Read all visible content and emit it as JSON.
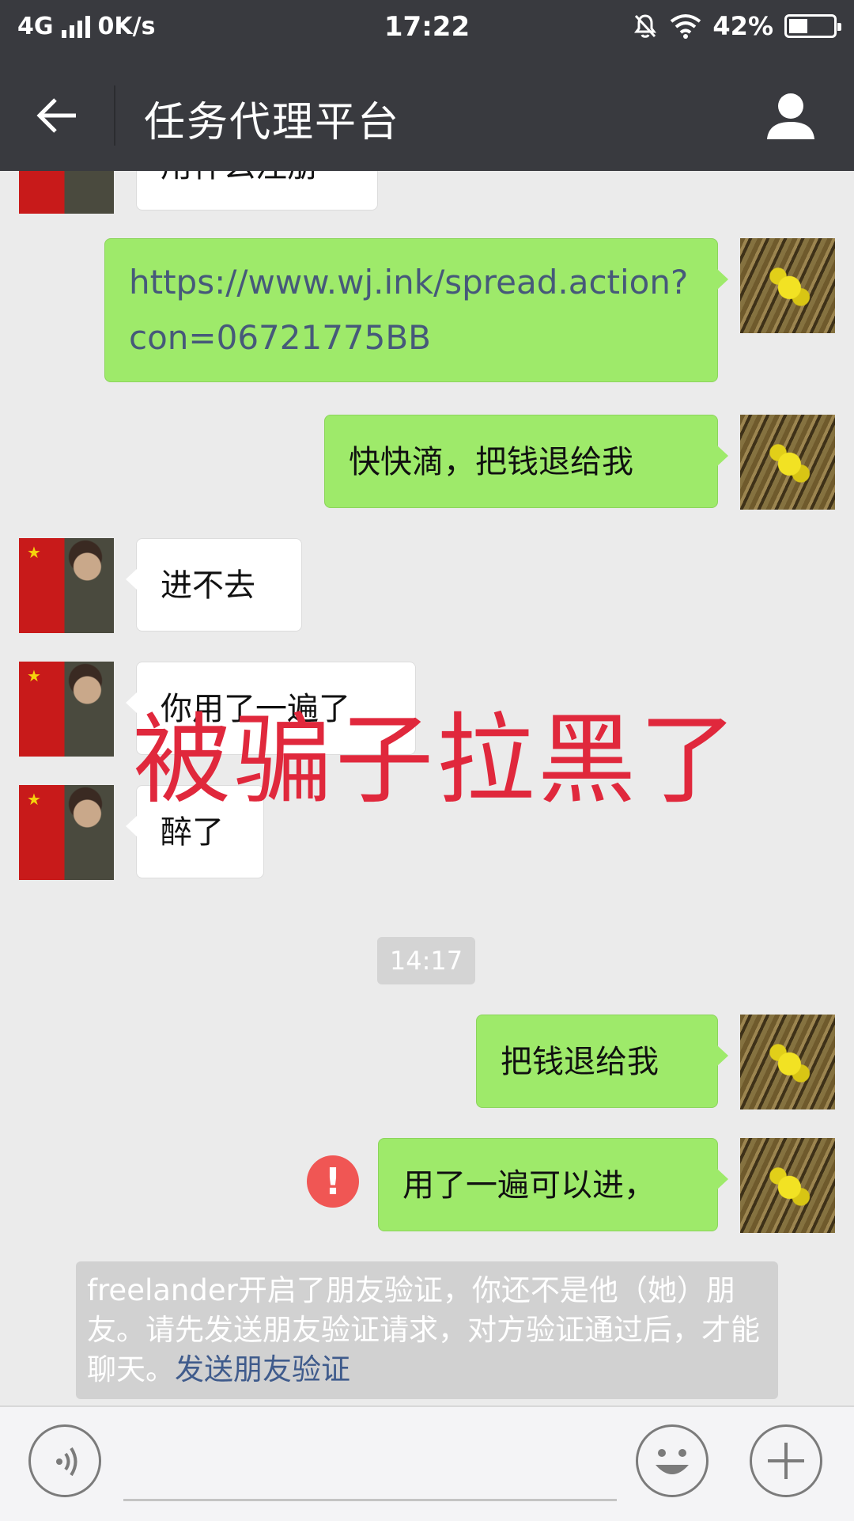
{
  "status_bar": {
    "network": "4G",
    "speed": "0K/s",
    "time": "17:22",
    "battery_percent": "42%",
    "battery_level": 0.42
  },
  "header": {
    "title": "任务代理平台",
    "back_icon": "arrow-left-icon",
    "profile_icon": "person-icon"
  },
  "messages": {
    "m0": {
      "text": "用什么注册"
    },
    "m1": {
      "text": "https://www.wj.ink/spread.action?con=06721775BB"
    },
    "m2": {
      "text": "快快滴，把钱退给我"
    },
    "m3": {
      "text": "进不去"
    },
    "m4": {
      "text": "你用了一遍了"
    },
    "m5": {
      "text": "醉了"
    },
    "m6": {
      "text": "把钱退给我"
    },
    "m7": {
      "text": "用了一遍可以进，"
    }
  },
  "timestamp": "14:17",
  "overlay_text": "被骗子拉黑了",
  "system_notice": {
    "text": "freelander开启了朋友验证，你还不是他（她）朋友。请先发送朋友验证请求，对方验证通过后，才能聊天。",
    "link": "发送朋友验证"
  },
  "input_bar": {
    "voice_icon": "voice-icon",
    "emoji_icon": "smiley-icon",
    "plus_icon": "plus-icon"
  }
}
